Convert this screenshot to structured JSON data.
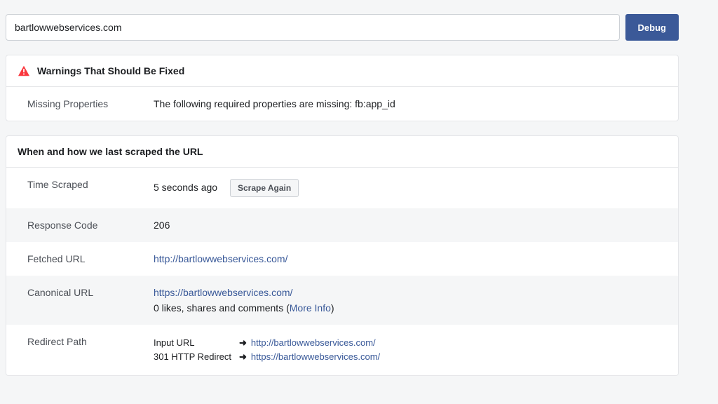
{
  "input": {
    "value": "bartlowwebservices.com",
    "debug_label": "Debug"
  },
  "warnings": {
    "title": "Warnings That Should Be Fixed",
    "rows": [
      {
        "label": "Missing Properties",
        "message": "The following required properties are missing: fb:app_id"
      }
    ]
  },
  "scrape": {
    "title": "When and how we last scraped the URL",
    "time_label": "Time Scraped",
    "time_value": "5 seconds ago",
    "scrape_again": "Scrape Again",
    "response_label": "Response Code",
    "response_value": "206",
    "fetched_label": "Fetched URL",
    "fetched_url": "http://bartlowwebservices.com/",
    "canonical_label": "Canonical URL",
    "canonical_url": "https://bartlowwebservices.com/",
    "social_prefix": "0 likes, shares and comments (",
    "more_info": "More Info",
    "social_suffix": ")",
    "redirect_label": "Redirect Path",
    "redirects": [
      {
        "label": "Input URL",
        "url": "http://bartlowwebservices.com/"
      },
      {
        "label": "301 HTTP Redirect",
        "url": "https://bartlowwebservices.com/"
      }
    ]
  }
}
